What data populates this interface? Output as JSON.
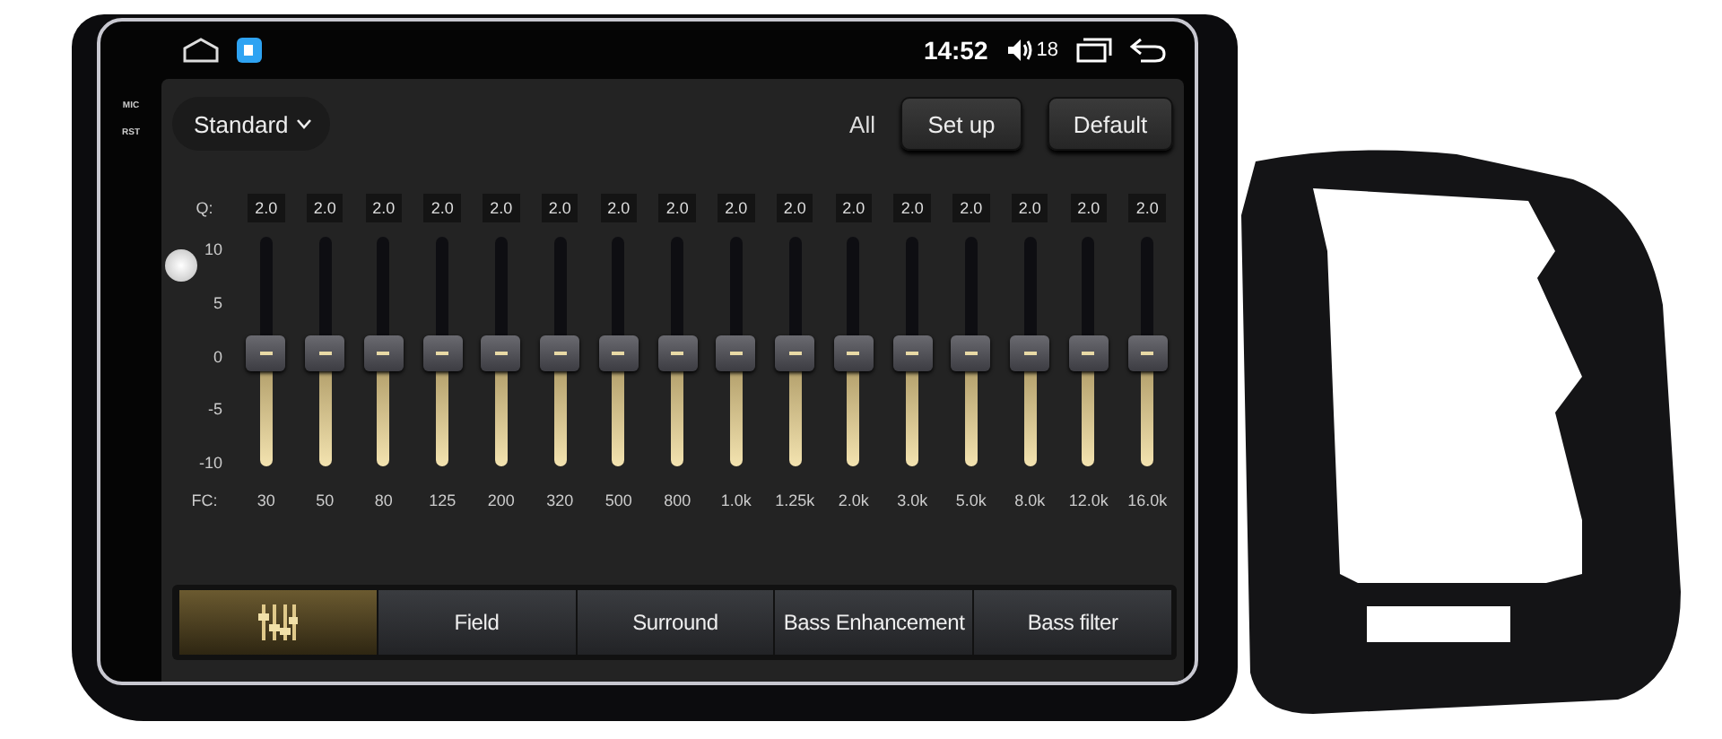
{
  "side_labels": [
    "MIC",
    "RST"
  ],
  "status_bar": {
    "time": "14:52",
    "volume": "18"
  },
  "toolbar": {
    "preset": "Standard",
    "all_label": "All",
    "buttons": [
      "Set up",
      "Default"
    ]
  },
  "equalizer": {
    "q_label": "Q:",
    "fc_label": "FC:",
    "axis": [
      "10",
      "5",
      "0",
      "-5",
      "-10"
    ],
    "bands": [
      {
        "q": "2.0",
        "fc": "30",
        "level": 0.5
      },
      {
        "q": "2.0",
        "fc": "50",
        "level": 0.5
      },
      {
        "q": "2.0",
        "fc": "80",
        "level": 0.5
      },
      {
        "q": "2.0",
        "fc": "125",
        "level": 0.5
      },
      {
        "q": "2.0",
        "fc": "200",
        "level": 0.5
      },
      {
        "q": "2.0",
        "fc": "320",
        "level": 0.5
      },
      {
        "q": "2.0",
        "fc": "500",
        "level": 0.5
      },
      {
        "q": "2.0",
        "fc": "800",
        "level": 0.5
      },
      {
        "q": "2.0",
        "fc": "1.0k",
        "level": 0.5
      },
      {
        "q": "2.0",
        "fc": "1.25k",
        "level": 0.5
      },
      {
        "q": "2.0",
        "fc": "2.0k",
        "level": 0.5
      },
      {
        "q": "2.0",
        "fc": "3.0k",
        "level": 0.5
      },
      {
        "q": "2.0",
        "fc": "5.0k",
        "level": 0.5
      },
      {
        "q": "2.0",
        "fc": "8.0k",
        "level": 0.5
      },
      {
        "q": "2.0",
        "fc": "12.0k",
        "level": 0.5
      },
      {
        "q": "2.0",
        "fc": "16.0k",
        "level": 0.5
      }
    ]
  },
  "tabs": [
    {
      "kind": "icon",
      "selected": true
    },
    {
      "kind": "text",
      "label": "Field",
      "selected": false
    },
    {
      "kind": "text",
      "label": "Surround",
      "selected": false
    },
    {
      "kind": "text",
      "label": "Bass Enhancement",
      "selected": false
    },
    {
      "kind": "text",
      "label": "Bass filter",
      "selected": false
    }
  ]
}
